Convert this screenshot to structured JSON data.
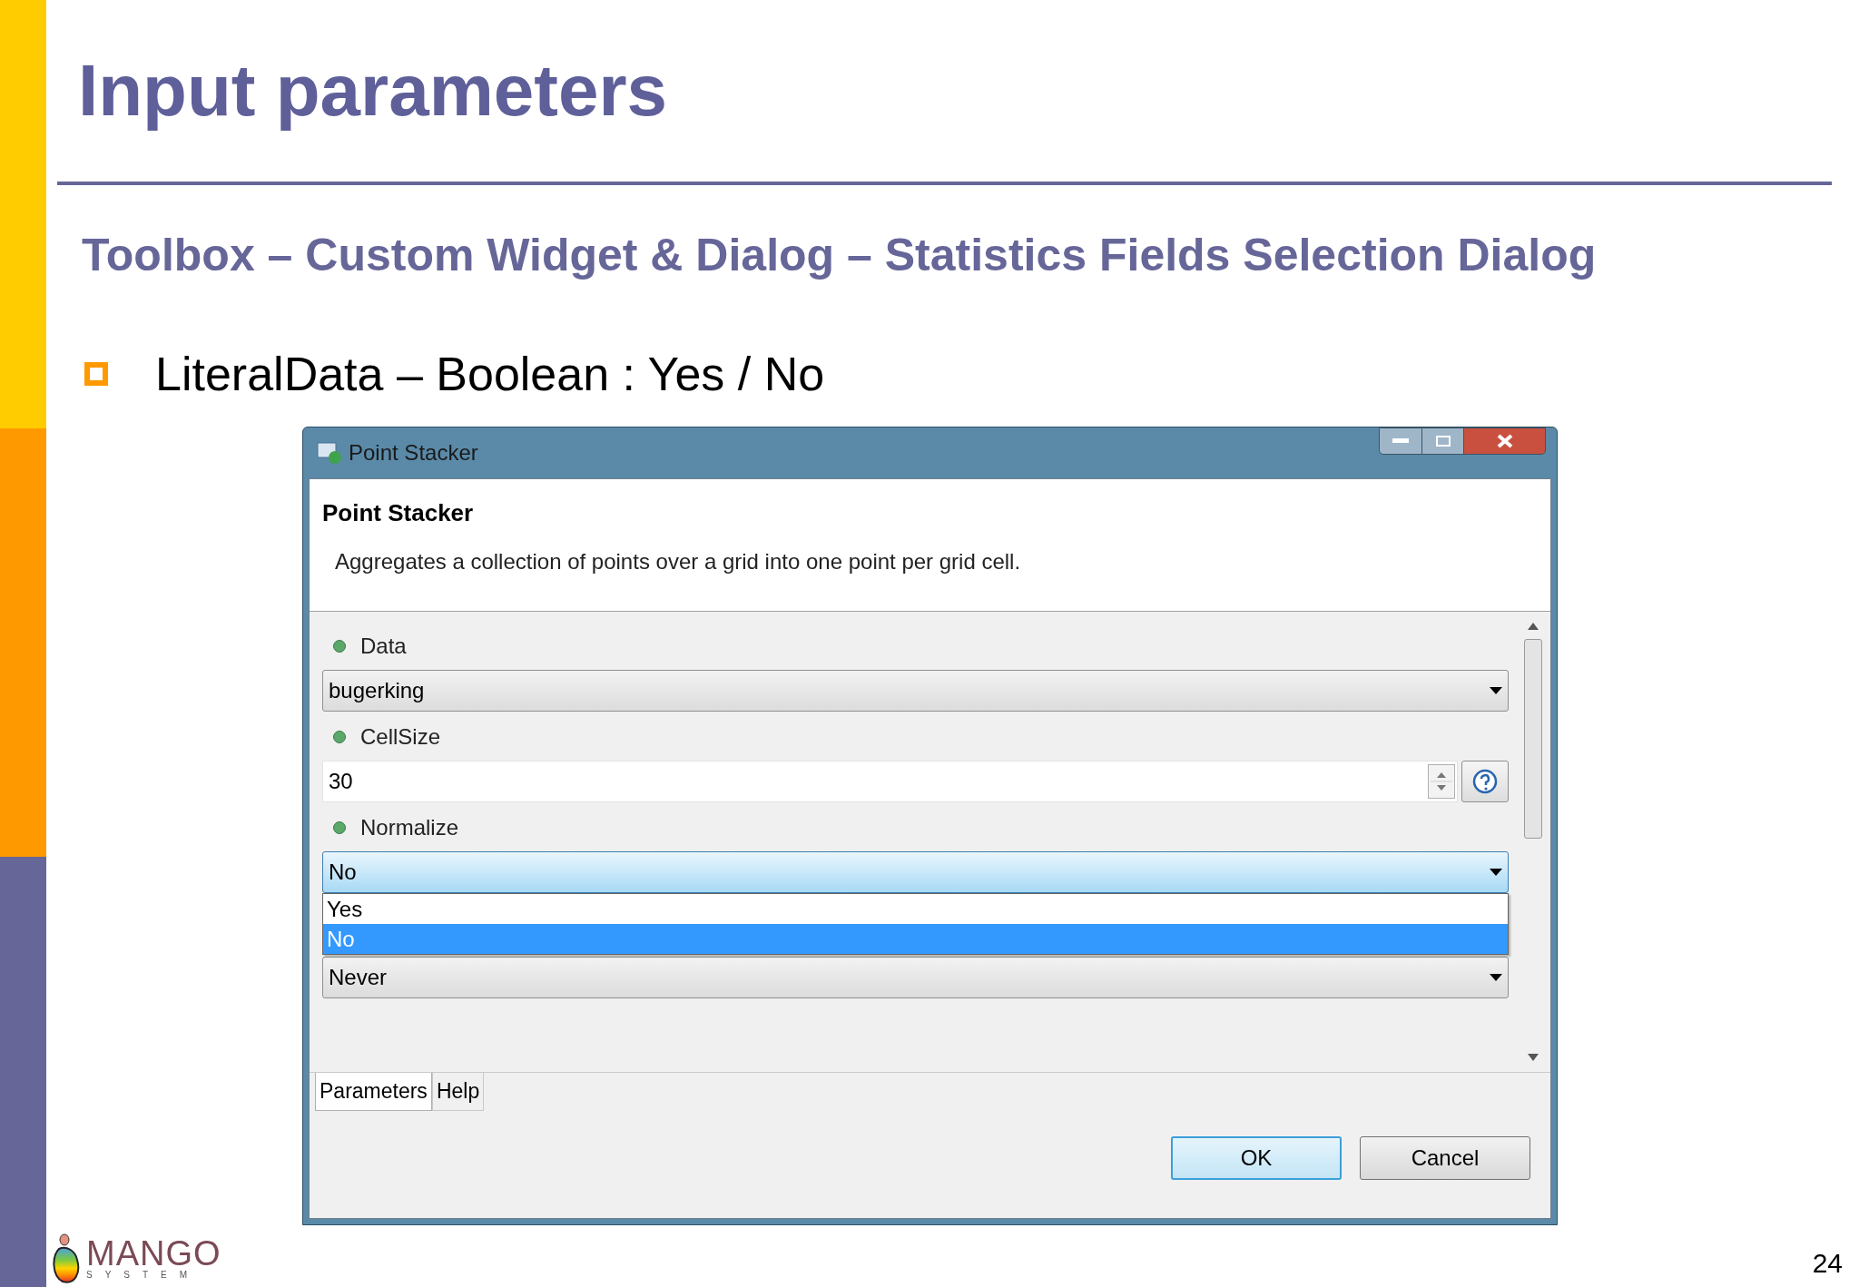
{
  "slide": {
    "title": "Input parameters",
    "subtitle": "Toolbox – Custom Widget & Dialog – Statistics Fields Selection Dialog",
    "bullets": [
      "LiteralData – Boolean : Yes / No"
    ],
    "page_number": "24"
  },
  "logo": {
    "name": "MANGO",
    "tagline": "SYSTEM"
  },
  "dialog": {
    "window": {
      "title": "Point Stacker"
    },
    "header": {
      "title": "Point Stacker",
      "description": "Aggregates a collection of points over a grid into one point per grid cell."
    },
    "parameters": [
      {
        "kind": "combo",
        "label": "Data",
        "value": "bugerking",
        "focused": false
      },
      {
        "kind": "spinner",
        "label": "CellSize",
        "value": "30"
      },
      {
        "kind": "combo",
        "label": "Normalize",
        "value": "No",
        "focused": true,
        "options": [
          {
            "label": "Yes",
            "selected": false
          },
          {
            "label": "No",
            "selected": true
          }
        ]
      },
      {
        "kind": "combo",
        "value": "Never",
        "focused": false
      }
    ],
    "tabs": [
      {
        "label": "Parameters",
        "selected": true
      },
      {
        "label": "Help",
        "selected": false
      }
    ],
    "buttons": [
      {
        "label": "OK",
        "default": true
      },
      {
        "label": "Cancel",
        "default": false
      }
    ]
  }
}
